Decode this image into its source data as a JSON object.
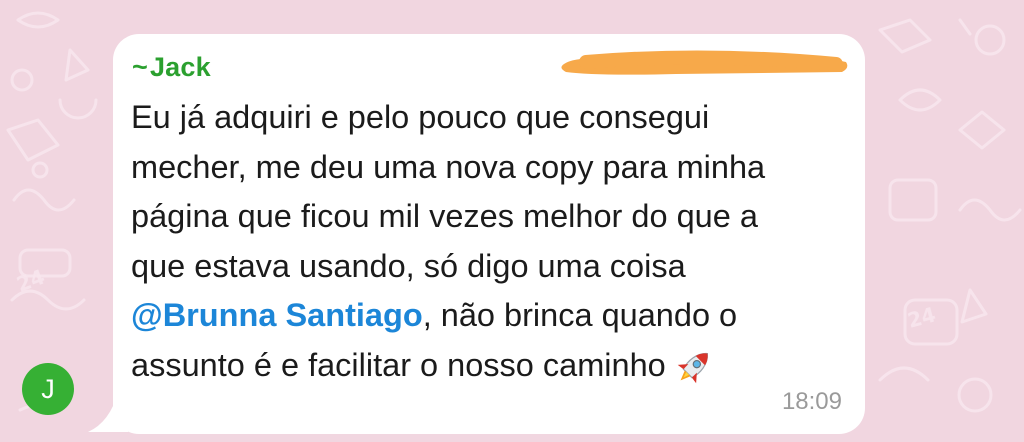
{
  "message": {
    "sender_prefix": "~",
    "sender_name": "Jack",
    "lines": [
      "Eu já adquiri e pelo pouco que consegui",
      "mecher, me deu uma nova copy para minha",
      "página que ficou mil vezes melhor do que a",
      "que estava usando, só digo uma coisa"
    ],
    "mention": "@Brunna Santiago",
    "after_mention": ", não brinca quando o",
    "last_line": "assunto é e facilitar o nosso caminho",
    "emoji": "rocket",
    "time": "18:09"
  },
  "avatar": {
    "initial": "J",
    "color": "#36b034"
  },
  "colors": {
    "background": "#f1d6e0",
    "sender": "#2ba02f",
    "mention": "#1c86d8",
    "redaction": "#f7a94a"
  },
  "icons": [
    "rocket-icon",
    "redaction-mark"
  ]
}
